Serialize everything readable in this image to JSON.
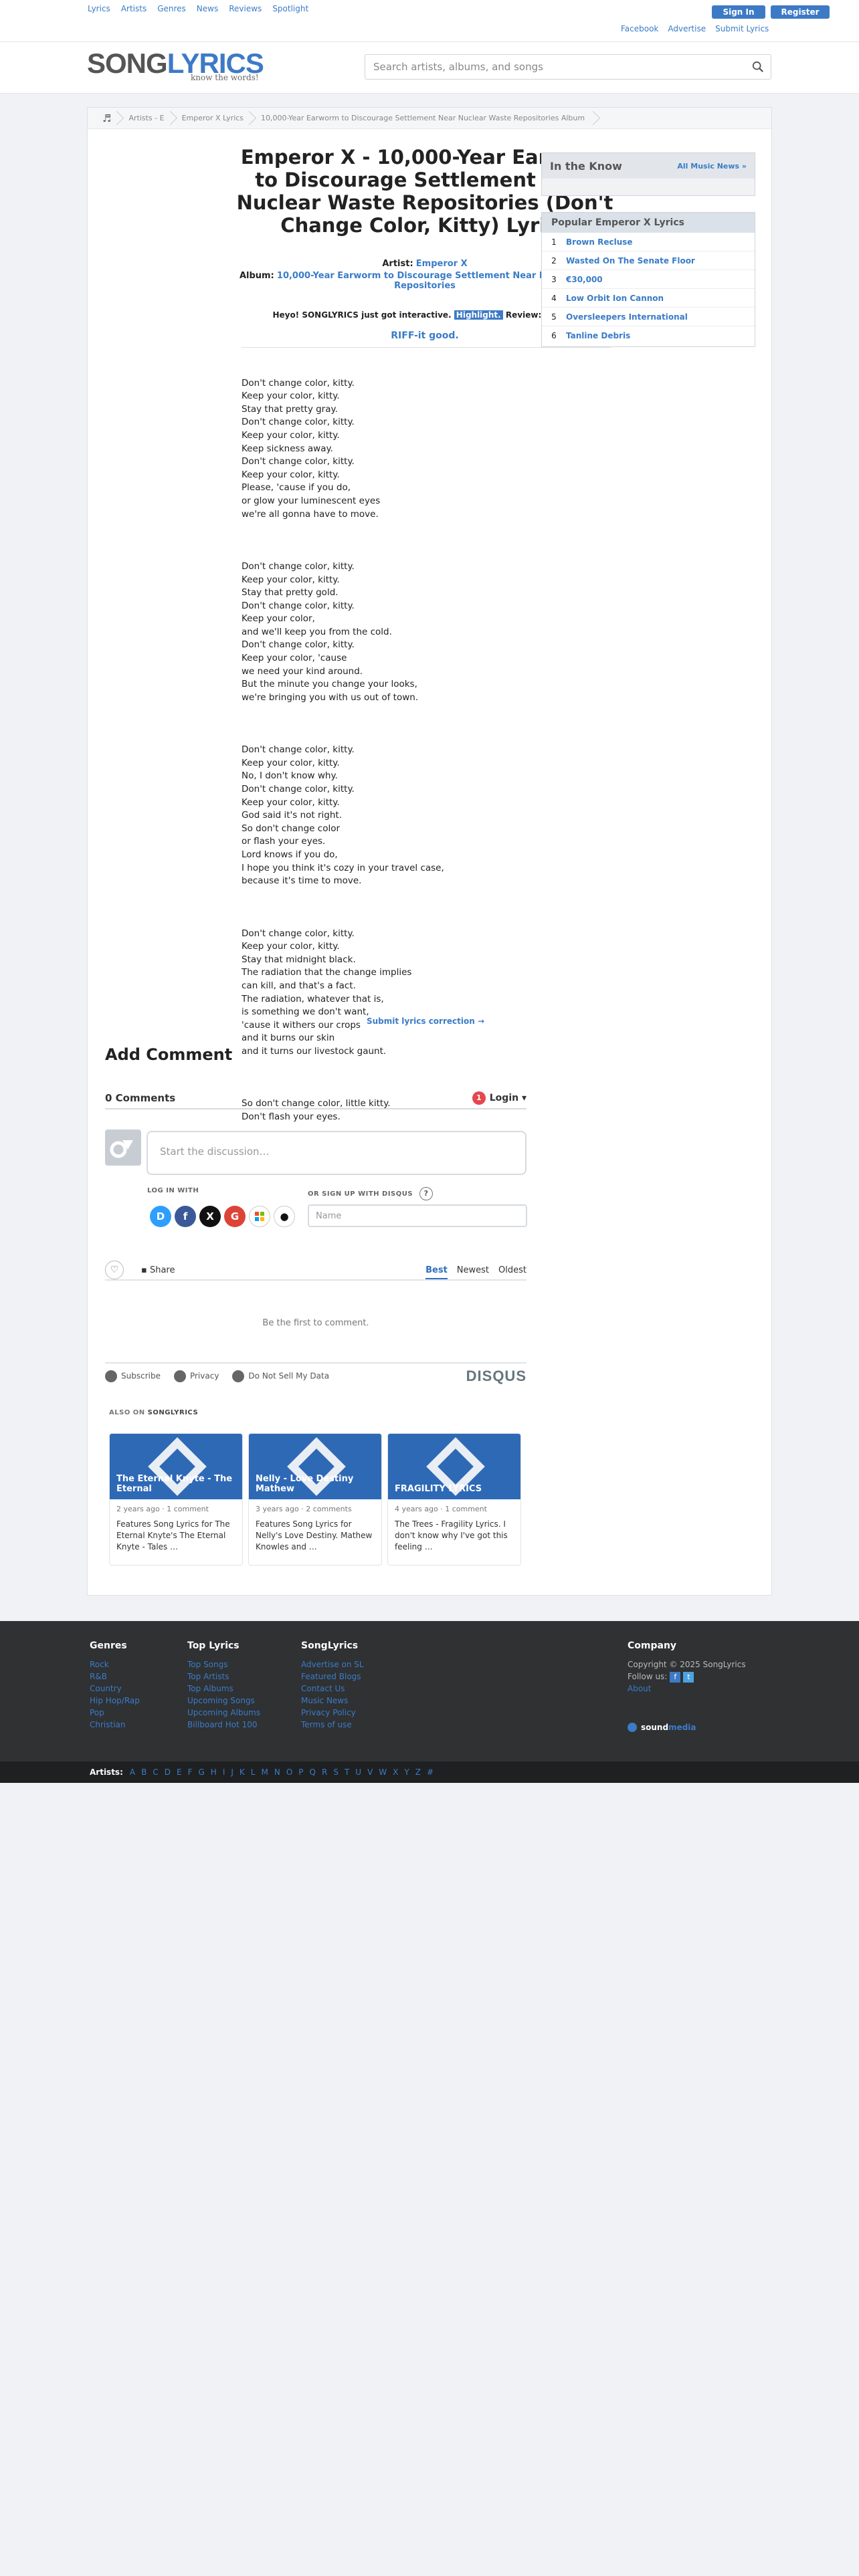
{
  "topnav": [
    "Lyrics",
    "Artists",
    "Genres",
    "News",
    "Reviews",
    "Spotlight"
  ],
  "auth": {
    "signin": "Sign In",
    "register": "Register"
  },
  "toplinks": [
    "Facebook",
    "Advertise",
    "Submit Lyrics"
  ],
  "logo": {
    "song": "SONG",
    "lyrics": "LYRICS",
    "tagline": "know the words!"
  },
  "search": {
    "placeholder": "Search artists, albums, and songs"
  },
  "breadcrumb": [
    "Artists - E",
    "Emperor X Lyrics",
    "10,000-Year Earworm to Discourage Settlement Near Nuclear Waste Repositories Album"
  ],
  "song": {
    "title": "Emperor X - 10,000-Year Earworm to Discourage Settlement Near Nuclear Waste Repositories (Don't Change Color, Kitty) Lyrics",
    "artist_label": "Artist:",
    "artist": "Emperor X",
    "album_label": "Album:",
    "album": "10,000-Year Earworm to Discourage Settlement Near Nuclear Waste Repositories"
  },
  "interactive": {
    "prefix": "Heyo! SONGLYRICS just got interactive.",
    "highlight": "Highlight.",
    "suffix": "Review: RIFF-it.",
    "riff": "RIFF-it good."
  },
  "lyrics": [
    "Don't change color, kitty.\nKeep your color, kitty.\nStay that pretty gray.\nDon't change color, kitty.\nKeep your color, kitty.\nKeep sickness away.\nDon't change color, kitty.\nKeep your color, kitty.\nPlease, 'cause if you do,\nor glow your luminescent eyes\nwe're all gonna have to move.",
    "Don't change color, kitty.\nKeep your color, kitty.\nStay that pretty gold.\nDon't change color, kitty.\nKeep your color,\nand we'll keep you from the cold.\nDon't change color, kitty.\nKeep your color, 'cause\nwe need your kind around.\nBut the minute you change your looks,\nwe're bringing you with us out of town.",
    "Don't change color, kitty.\nKeep your color, kitty.\nNo, I don't know why.\nDon't change color, kitty.\nKeep your color, kitty.\nGod said it's not right.\nSo don't change color\nor flash your eyes.\nLord knows if you do,\nI hope you think it's cozy in your travel case,\nbecause it's time to move.",
    "Don't change color, kitty.\nKeep your color, kitty.\nStay that midnight black.\nThe radiation that the change implies\ncan kill, and that's a fact.\nThe radiation, whatever that is,\nis something we don't want,\n'cause it withers our crops\nand it burns our skin\nand it turns our livestock gaunt.",
    "So don't change color, little kitty.\nDon't flash your eyes."
  ],
  "correction": "Submit lyrics correction →",
  "sidebar": {
    "know_title": "In the Know",
    "know_link": "All Music News »",
    "popular_title": "Popular Emperor X Lyrics",
    "popular": [
      {
        "n": "1",
        "t": "Brown Recluse"
      },
      {
        "n": "2",
        "t": "Wasted On The Senate Floor"
      },
      {
        "n": "3",
        "t": "€30,000"
      },
      {
        "n": "4",
        "t": "Low Orbit Ion Cannon"
      },
      {
        "n": "5",
        "t": "Oversleepers International"
      },
      {
        "n": "6",
        "t": "Tanline Debris"
      }
    ]
  },
  "comments": {
    "heading": "Add Comment",
    "count": "0 Comments",
    "badge": "1",
    "login": "Login ▾",
    "placeholder": "Start the discussion…",
    "login_with": "LOG IN WITH",
    "or_signup": "OR SIGN UP WITH DISQUS",
    "q": "?",
    "name_placeholder": "Name",
    "share": "Share",
    "sorts": [
      "Best",
      "Newest",
      "Oldest"
    ],
    "empty": "Be the first to comment.",
    "subscribe": "Subscribe",
    "privacy": "Privacy",
    "dnsmi": "Do Not Sell My Data",
    "disqus": "DISQUS",
    "also_prefix": "ALSO ON",
    "also_site": "SONGLYRICS"
  },
  "cards": [
    {
      "caption": "The Eternal Knyte - The Eternal",
      "meta": "2 years ago · 1 comment",
      "text": "Features Song Lyrics for The Eternal Knyte's The Eternal Knyte - Tales …"
    },
    {
      "caption": "Nelly - Love Destiny Mathew",
      "meta": "3 years ago · 2 comments",
      "text": "Features Song Lyrics for Nelly's Love Destiny. Mathew Knowles and …"
    },
    {
      "caption": "FRAGILITY LYRICS",
      "meta": "4 years ago · 1 comment",
      "text": "The Trees - Fragility Lyrics. I don't know why I've got this feeling …"
    }
  ],
  "footer": {
    "genres_title": "Genres",
    "genres": [
      "Rock",
      "R&B",
      "Country",
      "Hip Hop/Rap",
      "Pop",
      "Christian"
    ],
    "top_title": "Top Lyrics",
    "top": [
      "Top Songs",
      "Top Artists",
      "Top Albums",
      "Upcoming Songs",
      "Upcoming Albums",
      "Billboard Hot 100"
    ],
    "sl_title": "SongLyrics",
    "sl": [
      "Advertise on SL",
      "Featured Blogs",
      "Contact Us",
      "Music News",
      "Privacy Policy",
      "Terms of use"
    ],
    "company_title": "Company",
    "copyright": "Copyright © 2025 SongLyrics",
    "follow": "Follow us:",
    "about": "About",
    "soundmedia_a": "sound",
    "soundmedia_b": "media"
  },
  "artists_bar": {
    "label": "Artists:",
    "letters": [
      "A",
      "B",
      "C",
      "D",
      "E",
      "F",
      "G",
      "H",
      "I",
      "J",
      "K",
      "L",
      "M",
      "N",
      "O",
      "P",
      "Q",
      "R",
      "S",
      "T",
      "U",
      "V",
      "W",
      "X",
      "Y",
      "Z",
      "#"
    ]
  },
  "colors": {
    "accent": "#3d7ac6",
    "link": "#3a7cc7",
    "footer": "#2f3133"
  }
}
